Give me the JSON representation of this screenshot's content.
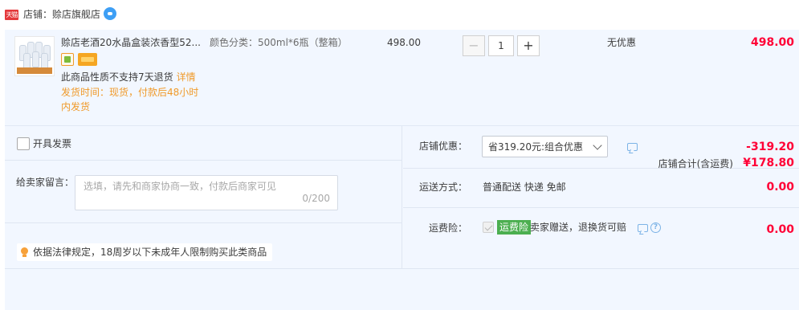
{
  "shop": {
    "badge": "天猫",
    "name": "店铺：赊店旗舰店",
    "contact_icon": "wangwang-chat-icon"
  },
  "item": {
    "title": "赊店老酒20水晶盒装浓香型52...",
    "sku": "颜色分类：500ml*6瓶（整箱）",
    "unit_price": "498.00",
    "quantity": "1",
    "qty_minus": "−",
    "qty_plus": "+",
    "promotion": "无优惠",
    "subtotal": "498.00",
    "return_policy": "此商品性质不支持7天退货",
    "return_detail_link": "详情",
    "ship_time": "发货时间：现货，付款后48小时内发货",
    "service_icons": [
      "guarantee-icon",
      "card-icon"
    ]
  },
  "invoice": {
    "label": "开具发票",
    "checked": false
  },
  "message": {
    "label": "给卖家留言：",
    "placeholder": "选填，请先和商家协商一致，付款后商家可见",
    "counter": "0/200"
  },
  "legal_notice": {
    "text": "依据法律规定，18周岁以下未成年人限制购买此类商品",
    "icon": "lightbulb-icon"
  },
  "shop_discount": {
    "label": "店铺优惠：",
    "selected": "省319.20元:组合优惠",
    "amount": "-319.20"
  },
  "shipping": {
    "label": "运送方式：",
    "method": "普通配送 快递 免邮",
    "amount": "0.00"
  },
  "insurance": {
    "label": "运费险：",
    "tag": "运费险",
    "text": "卖家赠送，退换货可赔",
    "amount": "0.00"
  },
  "total": {
    "label": "店铺合计(含运费)",
    "amount": "¥178.80"
  },
  "colors": {
    "accent_red": "#ff0036",
    "panel_bg": "#f2f7ff",
    "warning_orange": "#f09a2a",
    "insurance_green": "#4caf50"
  }
}
